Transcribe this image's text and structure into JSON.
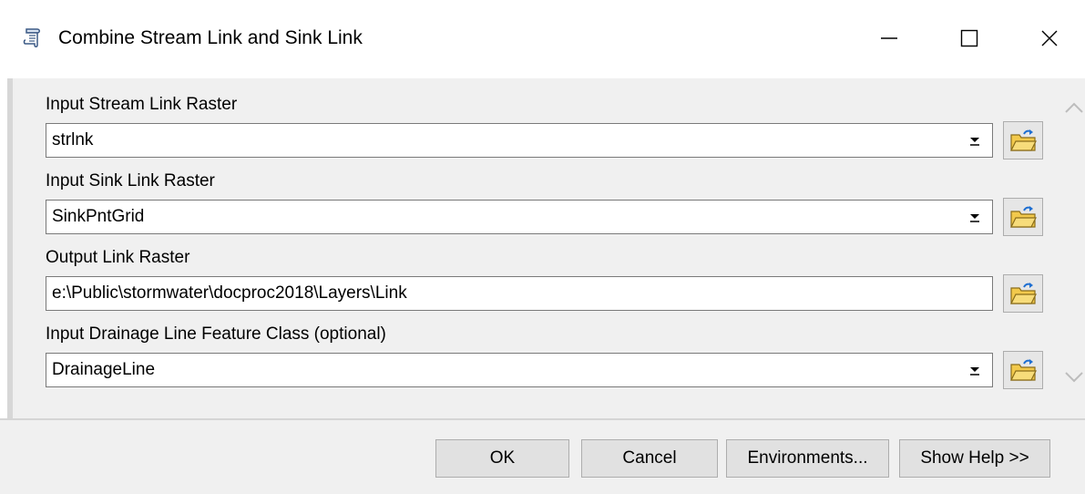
{
  "window": {
    "title": "Combine Stream Link and Sink Link",
    "icon": "script-scroll-icon"
  },
  "fields": {
    "stream_link": {
      "label": "Input Stream Link Raster",
      "value": "strlnk"
    },
    "sink_link": {
      "label": "Input Sink Link Raster",
      "value": "SinkPntGrid"
    },
    "output_link": {
      "label": "Output Link Raster",
      "value": "e:\\Public\\stormwater\\docproc2018\\Layers\\Link"
    },
    "drainage_line": {
      "label": "Input Drainage Line Feature Class (optional)",
      "value": "DrainageLine"
    }
  },
  "buttons": {
    "ok": "OK",
    "cancel": "Cancel",
    "environments": "Environments...",
    "show_help": "Show Help >>"
  },
  "icons": {
    "browse": "open-folder-icon",
    "dropdown": "dropdown-arrow-icon"
  },
  "colors": {
    "panel": "#f0f0f0",
    "folder": "#f2c94c",
    "folder_arrow": "#1f6fd1"
  }
}
